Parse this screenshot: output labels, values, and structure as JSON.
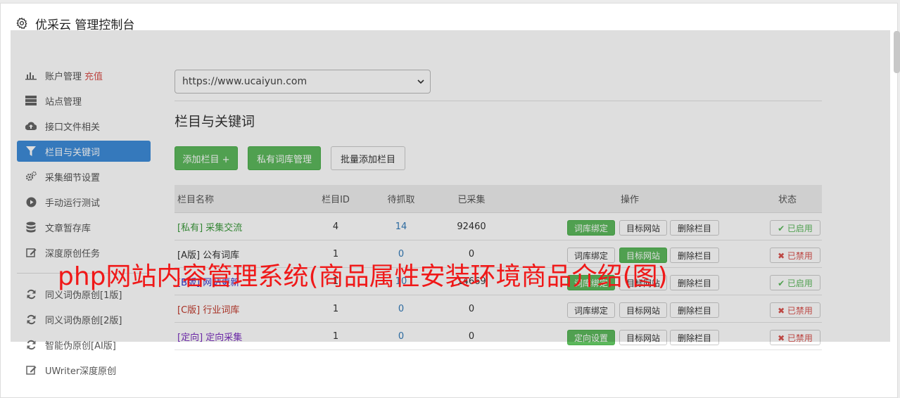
{
  "header": {
    "title": "优采云 管理控制台",
    "icon": "gear-icon"
  },
  "sidebar": {
    "items": [
      {
        "label": "账户管理",
        "extra": "充值",
        "icon": "bar-chart-icon"
      },
      {
        "label": "站点管理",
        "icon": "server-icon"
      },
      {
        "label": "接口文件相关",
        "icon": "cloud-upload-icon"
      },
      {
        "label": "栏目与关键词",
        "icon": "filter-icon",
        "active": true
      },
      {
        "label": "采集细节设置",
        "icon": "cogs-icon"
      },
      {
        "label": "手动运行测试",
        "icon": "play-circle-icon"
      },
      {
        "label": "文章暂存库",
        "icon": "database-icon"
      },
      {
        "label": "深度原创任务",
        "icon": "edit-icon"
      }
    ],
    "items2": [
      {
        "label": "同义词伪原创[1版]",
        "icon": "refresh-icon"
      },
      {
        "label": "同义词伪原创[2版]",
        "icon": "refresh-icon"
      },
      {
        "label": "智能伪原创[AI版]",
        "icon": "refresh-icon"
      },
      {
        "label": "UWriter深度原创",
        "icon": "edit-icon"
      }
    ]
  },
  "site_select": {
    "value": "https://www.ucaiyun.com"
  },
  "section_title": "栏目与关键词",
  "buttons": {
    "add": "添加栏目 +",
    "private": "私有词库管理",
    "batch": "批量添加栏目"
  },
  "table": {
    "headers": [
      "栏目名称",
      "栏目ID",
      "待抓取",
      "已采集",
      "操作",
      "状态"
    ],
    "rows": [
      {
        "name": "[私有] 采集交流",
        "name_color": "#3c9a3c",
        "id": "4",
        "wait": "14",
        "done": "92460",
        "op1": "词库绑定",
        "op1_green": true,
        "op2": "目标网站",
        "op2_green": false,
        "op3": "删除栏目",
        "status": "✔ 已启用",
        "status_on": true
      },
      {
        "name": "[A版] 公有词库",
        "name_color": "#333333",
        "id": "1",
        "wait": "0",
        "done": "0",
        "op1": "词库绑定",
        "op1_green": false,
        "op2": "目标网站",
        "op2_green": true,
        "op3": "删除栏目",
        "status": "✖ 已禁用",
        "status_on": false
      },
      {
        "name": "[B版] 网站更新",
        "name_color": "#3333cc",
        "id": "1",
        "wait": "10",
        "done": "14669",
        "op1": "词库绑定",
        "op1_green": true,
        "op2": "目标网站",
        "op2_green": false,
        "op3": "删除栏目",
        "status": "✔ 已启用",
        "status_on": true
      },
      {
        "name": "[C版] 行业词库",
        "name_color": "#c0392b",
        "id": "1",
        "wait": "0",
        "done": "0",
        "op1": "词库绑定",
        "op1_green": false,
        "op2": "目标网站",
        "op2_green": false,
        "op3": "删除栏目",
        "status": "✖ 已禁用",
        "status_on": false
      },
      {
        "name": "[定向] 定向采集",
        "name_color": "#7b2fbf",
        "id": "1",
        "wait": "0",
        "done": "0",
        "op1": "定向设置",
        "op1_green": true,
        "op2": "目标网站",
        "op2_green": false,
        "op3": "删除栏目",
        "status": "✖ 已禁用",
        "status_on": false
      }
    ]
  },
  "watermark": "php网站内容管理系统(商品属性安装环境商品介绍(图)"
}
